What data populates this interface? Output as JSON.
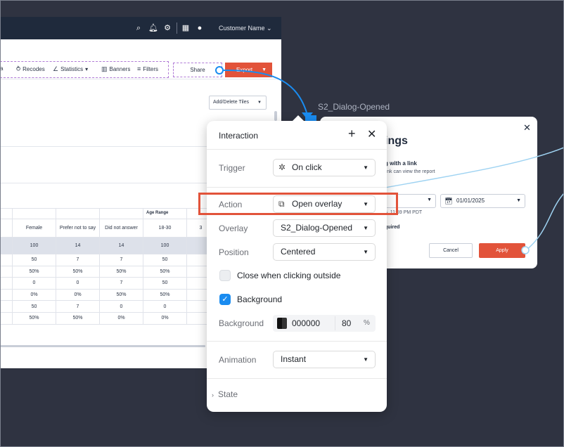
{
  "app": {
    "topbar": {
      "icons": [
        "search-icon",
        "bell-icon",
        "gear-icon",
        "apps-grid-icon",
        "user-icon"
      ],
      "customer_name": "Customer Name"
    },
    "toolbar": {
      "partial_item": "a",
      "recodes": "Recodes",
      "statistics": "Statistics",
      "banners": "Banners",
      "filters": "Filters",
      "share": "Share",
      "export": "Export"
    },
    "add_delete_tiles": "Add/Delete Tiles",
    "age_range_header": "Age Range",
    "table": {
      "headers": [
        "",
        "Female",
        "Prefer not to say",
        "Did not answer",
        "18-30",
        "3"
      ],
      "total_row": [
        "",
        "100",
        "14",
        "14",
        "100",
        ""
      ],
      "rows": [
        [
          "",
          "50",
          "7",
          "7",
          "50",
          ""
        ],
        [
          "",
          "50%",
          "50%",
          "50%",
          "50%",
          ""
        ],
        [
          "",
          "0",
          "0",
          "7",
          "50",
          ""
        ],
        [
          "",
          "0%",
          "0%",
          "50%",
          "50%",
          ""
        ],
        [
          "",
          "50",
          "7",
          "0",
          "0",
          ""
        ],
        [
          "",
          "50%",
          "50%",
          "0%",
          "0%",
          ""
        ]
      ]
    }
  },
  "overlay_label": "S2_Dialog-Opened",
  "dialog": {
    "title_fragment": "ings",
    "link_heading": "g with a link",
    "link_sub": "link can view the report",
    "date_value": "01/01/2025",
    "expiry_text": "5, 11:59 PM PDT",
    "required_text": "quired",
    "cancel": "Cancel",
    "apply": "Apply"
  },
  "panel": {
    "title": "Interaction",
    "trigger_label": "Trigger",
    "trigger_value": "On click",
    "action_label": "Action",
    "action_value": "Open overlay",
    "overlay_label": "Overlay",
    "overlay_value": "S2_Dialog-Opened",
    "position_label": "Position",
    "position_value": "Centered",
    "close_outside_label": "Close when clicking outside",
    "close_outside_checked": false,
    "background_checkbox_label": "Background",
    "background_checked": true,
    "background_label": "Background",
    "background_hex": "000000",
    "background_opacity": "80",
    "background_percent": "%",
    "animation_label": "Animation",
    "animation_value": "Instant",
    "state_label": "State"
  },
  "colors": {
    "canvas": "#2f3341",
    "topbar": "#1f2a3c",
    "accent_orange": "#e2533a",
    "link_blue": "#1a8cf0"
  }
}
